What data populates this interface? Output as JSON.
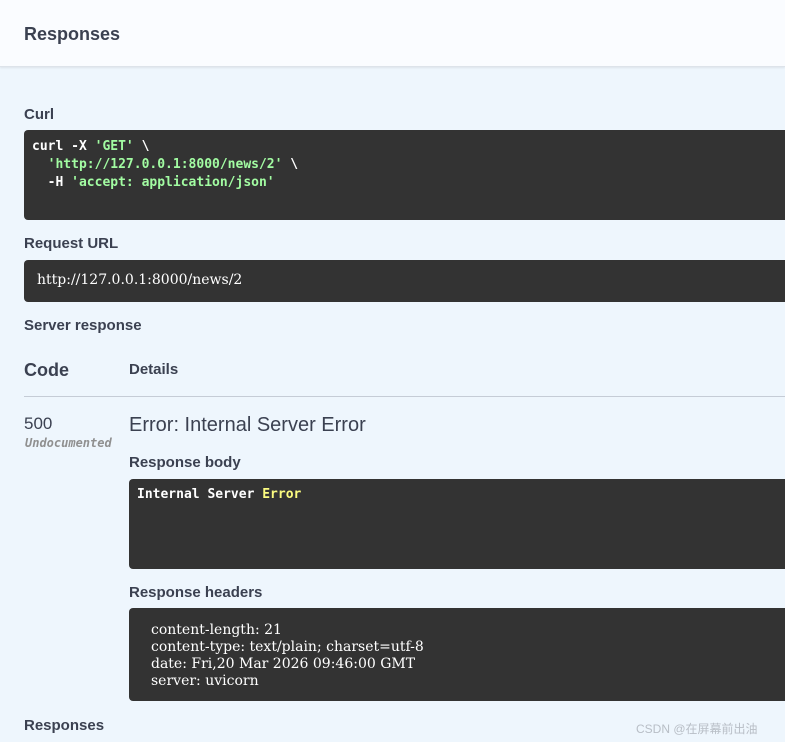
{
  "header": {
    "title": "Responses"
  },
  "curl": {
    "label": "Curl",
    "line1_cmd": "curl -X ",
    "line1_method": "'GET'",
    "line1_tail": " \\",
    "line2_indent": "  ",
    "line2_url": "'http://127.0.0.1:8000/news/2'",
    "line2_tail": " \\",
    "line3_flag": "  -H ",
    "line3_header": "'accept: application/json'"
  },
  "request_url": {
    "label": "Request URL",
    "value": "http://127.0.0.1:8000/news/2"
  },
  "server_response": {
    "label": "Server response",
    "col_code": "Code",
    "col_details": "Details",
    "code": "500",
    "code_note": "Undocumented",
    "error_title": "Error: Internal Server Error",
    "body_label": "Response body",
    "body_text": "Internal Server ",
    "body_highlight": "Error",
    "headers_label": "Response headers",
    "headers": [
      "content-length: 21",
      "content-type: text/plain; charset=utf-8",
      "date: Fri,20 Mar 2026 09:46:00 GMT",
      "server: uvicorn"
    ]
  },
  "footer": {
    "responses_label": "Responses"
  },
  "watermark": "CSDN @在屏幕前出油"
}
